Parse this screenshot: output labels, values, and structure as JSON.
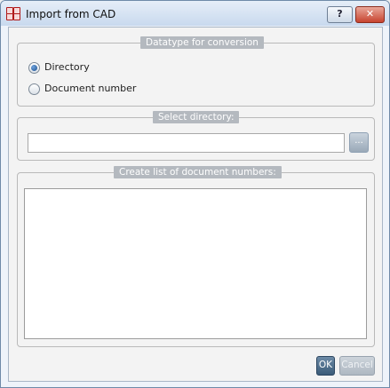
{
  "window": {
    "title": "Import from CAD",
    "help_label": "?",
    "close_label": "✕"
  },
  "datatype_group": {
    "legend": "Datatype for conversion",
    "options": [
      {
        "label": "Directory",
        "checked": true
      },
      {
        "label": "Document number",
        "checked": false
      }
    ]
  },
  "directory_group": {
    "legend": "Select directory:",
    "input_value": "",
    "browse_label": "..."
  },
  "doclist_group": {
    "legend": "Create list of document numbers:"
  },
  "footer": {
    "ok_label": "OK",
    "cancel_label": "Cancel"
  },
  "colors": {
    "legend_bg": "#b4b9bf",
    "ok_button": "#4a6a88",
    "close_button": "#c7432f"
  }
}
